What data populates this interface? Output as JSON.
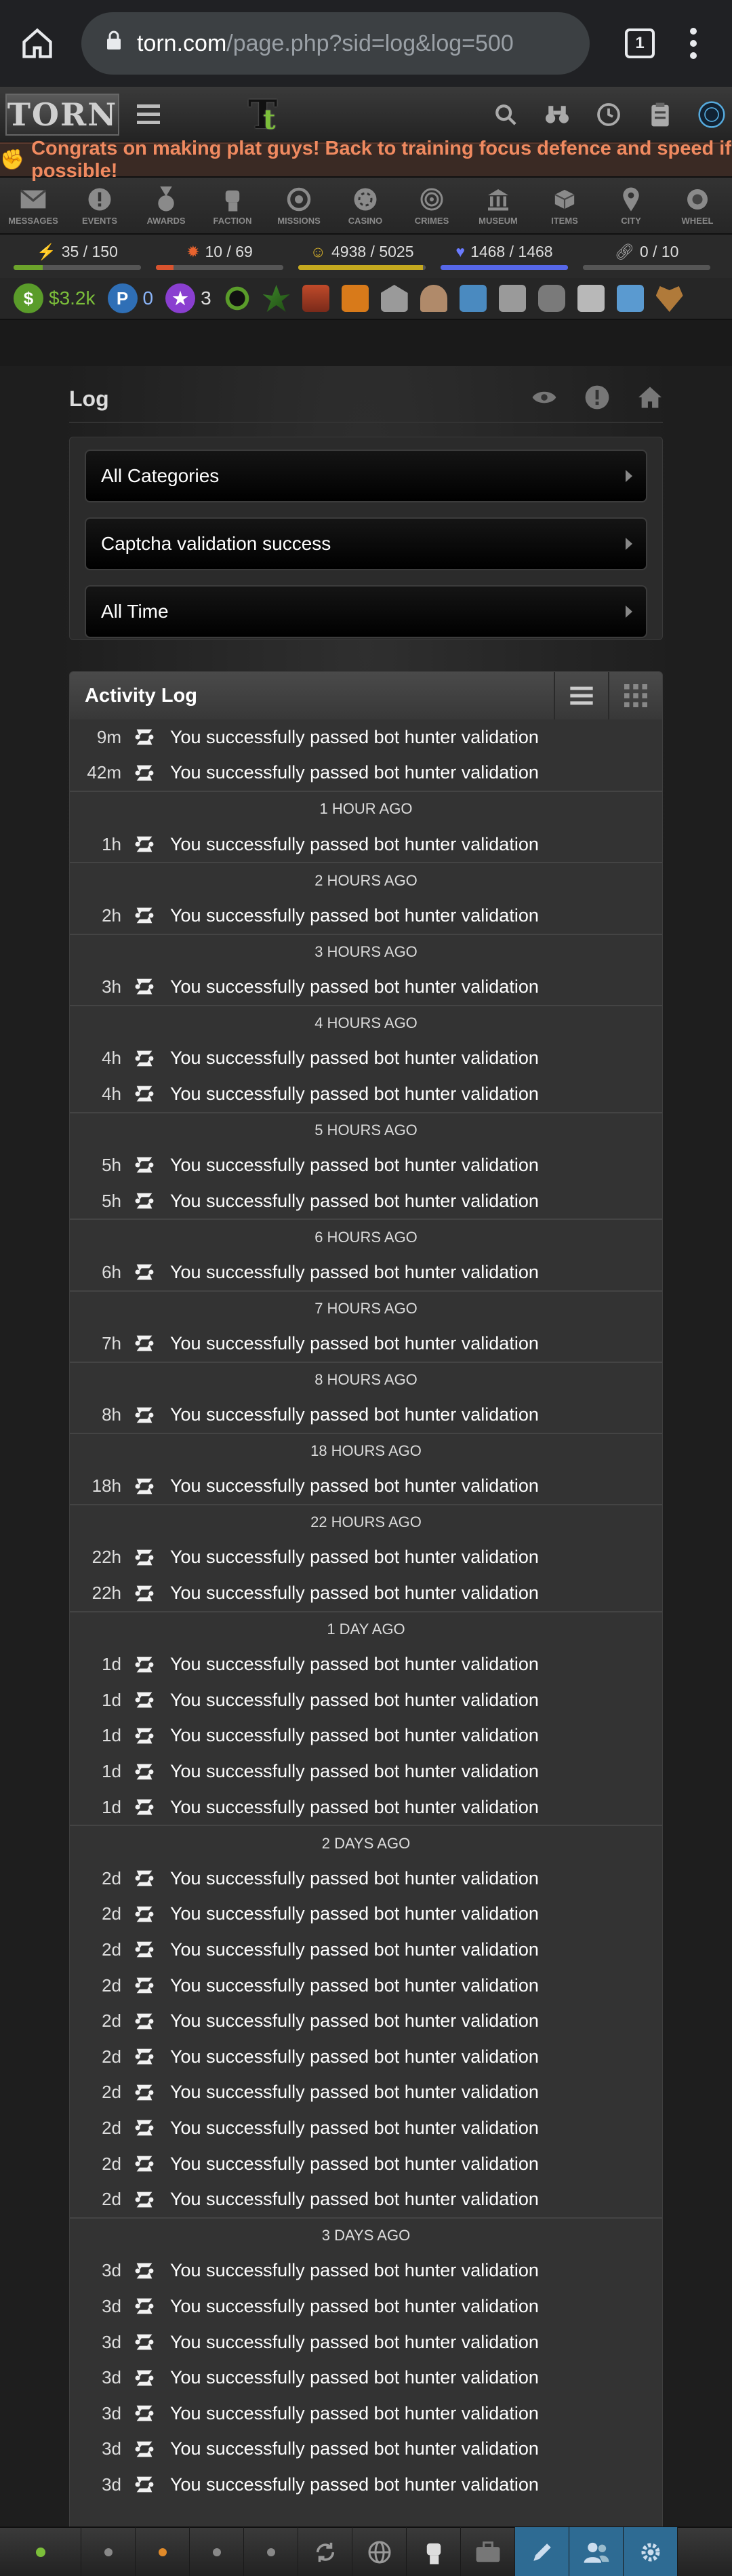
{
  "browser": {
    "url_domain": "torn.com",
    "url_path": "/page.php?sid=log&log=500",
    "tab_count": "1"
  },
  "header": {
    "logo_text": "TORN",
    "tt_logo": "T",
    "tt_logo_small": "t"
  },
  "announcement": {
    "text": "Congrats on making plat guys! Back to training focus defence and speed if possible!"
  },
  "nav": [
    {
      "label": "MESSAGES",
      "icon": "envelope-icon"
    },
    {
      "label": "EVENTS",
      "icon": "exclamation-icon"
    },
    {
      "label": "AWARDS",
      "icon": "medal-icon"
    },
    {
      "label": "FACTION",
      "icon": "fist-icon"
    },
    {
      "label": "MISSIONS",
      "icon": "target-icon"
    },
    {
      "label": "CASINO",
      "icon": "chip-icon"
    },
    {
      "label": "CRIMES",
      "icon": "fingerprint-icon"
    },
    {
      "label": "MUSEUM",
      "icon": "museum-icon"
    },
    {
      "label": "ITEMS",
      "icon": "box-icon"
    },
    {
      "label": "CITY",
      "icon": "pin-icon"
    },
    {
      "label": "WHEEL",
      "icon": "wheel-icon"
    }
  ],
  "bars": [
    {
      "name": "energy",
      "value": "35 / 150",
      "fill": 0.23,
      "color": "#6ca32b"
    },
    {
      "name": "nerve",
      "value": "10 / 69",
      "fill": 0.14,
      "color": "#d9532e"
    },
    {
      "name": "happy",
      "value": "4938 / 5025",
      "fill": 0.98,
      "color": "#c5a91f"
    },
    {
      "name": "life",
      "value": "1468 / 1468",
      "fill": 1.0,
      "color": "#5667e8"
    },
    {
      "name": "chain",
      "value": "0 / 10",
      "fill": 0.0,
      "color": "#999999"
    }
  ],
  "status": {
    "money": "$3.2k",
    "points": "0",
    "merits": "3"
  },
  "page": {
    "title": "Log"
  },
  "filters": {
    "category": "All Categories",
    "type": "Captcha validation success",
    "time": "All Time"
  },
  "log": {
    "title": "Activity Log",
    "items": [
      {
        "kind": "row",
        "time": "9m",
        "msg": "You successfully passed bot hunter validation"
      },
      {
        "kind": "row",
        "time": "42m",
        "msg": "You successfully passed bot hunter validation"
      },
      {
        "kind": "sep",
        "label": "1 HOUR AGO"
      },
      {
        "kind": "row",
        "time": "1h",
        "msg": "You successfully passed bot hunter validation"
      },
      {
        "kind": "sep",
        "label": "2 HOURS AGO"
      },
      {
        "kind": "row",
        "time": "2h",
        "msg": "You successfully passed bot hunter validation"
      },
      {
        "kind": "sep",
        "label": "3 HOURS AGO"
      },
      {
        "kind": "row",
        "time": "3h",
        "msg": "You successfully passed bot hunter validation"
      },
      {
        "kind": "sep",
        "label": "4 HOURS AGO"
      },
      {
        "kind": "row",
        "time": "4h",
        "msg": "You successfully passed bot hunter validation"
      },
      {
        "kind": "row",
        "time": "4h",
        "msg": "You successfully passed bot hunter validation"
      },
      {
        "kind": "sep",
        "label": "5 HOURS AGO"
      },
      {
        "kind": "row",
        "time": "5h",
        "msg": "You successfully passed bot hunter validation"
      },
      {
        "kind": "row",
        "time": "5h",
        "msg": "You successfully passed bot hunter validation"
      },
      {
        "kind": "sep",
        "label": "6 HOURS AGO"
      },
      {
        "kind": "row",
        "time": "6h",
        "msg": "You successfully passed bot hunter validation"
      },
      {
        "kind": "sep",
        "label": "7 HOURS AGO"
      },
      {
        "kind": "row",
        "time": "7h",
        "msg": "You successfully passed bot hunter validation"
      },
      {
        "kind": "sep",
        "label": "8 HOURS AGO"
      },
      {
        "kind": "row",
        "time": "8h",
        "msg": "You successfully passed bot hunter validation"
      },
      {
        "kind": "sep",
        "label": "18 HOURS AGO"
      },
      {
        "kind": "row",
        "time": "18h",
        "msg": "You successfully passed bot hunter validation"
      },
      {
        "kind": "sep",
        "label": "22 HOURS AGO"
      },
      {
        "kind": "row",
        "time": "22h",
        "msg": "You successfully passed bot hunter validation"
      },
      {
        "kind": "row",
        "time": "22h",
        "msg": "You successfully passed bot hunter validation"
      },
      {
        "kind": "sep",
        "label": "1 DAY AGO"
      },
      {
        "kind": "row",
        "time": "1d",
        "msg": "You successfully passed bot hunter validation"
      },
      {
        "kind": "row",
        "time": "1d",
        "msg": "You successfully passed bot hunter validation"
      },
      {
        "kind": "row",
        "time": "1d",
        "msg": "You successfully passed bot hunter validation"
      },
      {
        "kind": "row",
        "time": "1d",
        "msg": "You successfully passed bot hunter validation"
      },
      {
        "kind": "row",
        "time": "1d",
        "msg": "You successfully passed bot hunter validation"
      },
      {
        "kind": "sep",
        "label": "2 DAYS AGO"
      },
      {
        "kind": "row",
        "time": "2d",
        "msg": "You successfully passed bot hunter validation"
      },
      {
        "kind": "row",
        "time": "2d",
        "msg": "You successfully passed bot hunter validation"
      },
      {
        "kind": "row",
        "time": "2d",
        "msg": "You successfully passed bot hunter validation"
      },
      {
        "kind": "row",
        "time": "2d",
        "msg": "You successfully passed bot hunter validation"
      },
      {
        "kind": "row",
        "time": "2d",
        "msg": "You successfully passed bot hunter validation"
      },
      {
        "kind": "row",
        "time": "2d",
        "msg": "You successfully passed bot hunter validation"
      },
      {
        "kind": "row",
        "time": "2d",
        "msg": "You successfully passed bot hunter validation"
      },
      {
        "kind": "row",
        "time": "2d",
        "msg": "You successfully passed bot hunter validation"
      },
      {
        "kind": "row",
        "time": "2d",
        "msg": "You successfully passed bot hunter validation"
      },
      {
        "kind": "row",
        "time": "2d",
        "msg": "You successfully passed bot hunter validation"
      },
      {
        "kind": "sep",
        "label": "3 DAYS AGO"
      },
      {
        "kind": "row",
        "time": "3d",
        "msg": "You successfully passed bot hunter validation"
      },
      {
        "kind": "row",
        "time": "3d",
        "msg": "You successfully passed bot hunter validation"
      },
      {
        "kind": "row",
        "time": "3d",
        "msg": "You successfully passed bot hunter validation"
      },
      {
        "kind": "row",
        "time": "3d",
        "msg": "You successfully passed bot hunter validation"
      },
      {
        "kind": "row",
        "time": "3d",
        "msg": "You successfully passed bot hunter validation"
      },
      {
        "kind": "row",
        "time": "3d",
        "msg": "You successfully passed bot hunter validation"
      },
      {
        "kind": "row",
        "time": "3d",
        "msg": "You successfully passed bot hunter validation"
      }
    ]
  },
  "bottombar": [
    {
      "icon": "green-dot-icon"
    },
    {
      "icon": "grey-dot-icon"
    },
    {
      "icon": "orange-dot-icon"
    },
    {
      "icon": "grey-dot-icon"
    },
    {
      "icon": "grey-dot-icon"
    },
    {
      "icon": "recycle-icon"
    },
    {
      "icon": "globe-icon"
    },
    {
      "icon": "fist-icon"
    },
    {
      "icon": "briefcase-icon"
    },
    {
      "icon": "pencil-icon"
    },
    {
      "icon": "people-icon"
    },
    {
      "icon": "gear-icon"
    }
  ]
}
